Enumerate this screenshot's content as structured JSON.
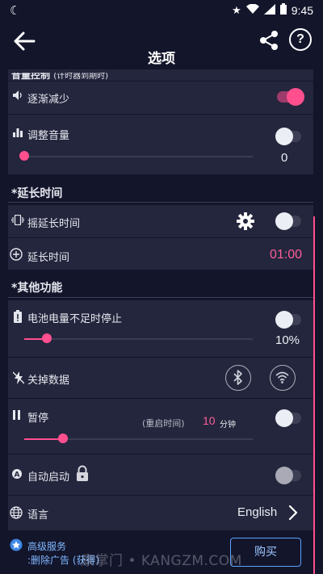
{
  "status_bar": {
    "left_icon": "moon-app-icon",
    "time": "9:45",
    "icons": [
      "star-icon",
      "wifi-icon",
      "signal-icon",
      "battery-icon"
    ]
  },
  "header": {
    "title": "选项",
    "back_icon": "arrow-left-icon",
    "share_icon": "share-icon",
    "help_label": "?"
  },
  "volume_section": {
    "partial_header": "音量控制",
    "partial_header_note": "(计时器到期时)",
    "fade_out": {
      "label": "逐渐减少",
      "enabled": true
    },
    "adjust_volume": {
      "label": "调整音量",
      "enabled": false,
      "value": "0",
      "level": 0
    }
  },
  "extend_section": {
    "header": "*延长时间",
    "shake_extend": {
      "label": "摇延长时间",
      "enabled": false
    },
    "extend_time": {
      "label": "延长时间",
      "value": "01:00"
    }
  },
  "other_section": {
    "header": "*其他功能",
    "battery_stop": {
      "label": "电池电量不足时停止",
      "enabled": false,
      "value": "10%",
      "level": 0.1
    },
    "turn_off_data": {
      "label": "关掉数据"
    },
    "pause": {
      "label": "暂停",
      "enabled": false,
      "restart_note": "(重启时间)",
      "restart_value": "10",
      "restart_unit": "分钟",
      "level": 0.17
    },
    "auto_start": {
      "label": "自动启动",
      "enabled": false
    },
    "language": {
      "label": "语言",
      "value": "English"
    }
  },
  "bottom": {
    "premium_label": "高级服务",
    "remove_ads_label": ":删除广告 (获得)",
    "buy_label": "购买",
    "watermark": "康掌门 • KANGZM.COM"
  },
  "colors": {
    "background": "#13152b",
    "card": "#24263d",
    "accent": "#ff4f8e",
    "link": "#7fb8ff"
  }
}
